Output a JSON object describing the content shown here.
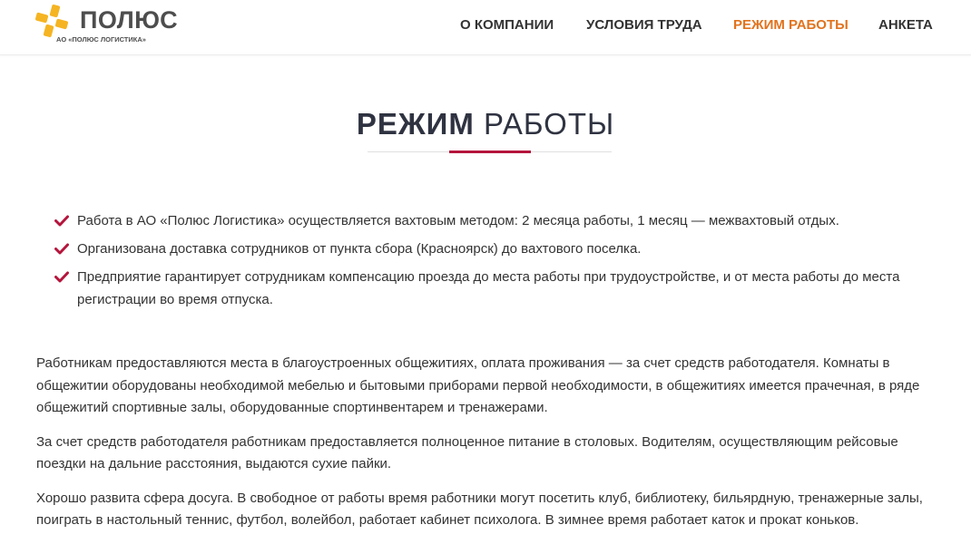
{
  "header": {
    "logo_name": "ПОЛЮС",
    "logo_sub": "АО «ПОЛЮС ЛОГИСТИКА»",
    "nav": [
      {
        "label": "О КОМПАНИИ"
      },
      {
        "label": "УСЛОВИЯ ТРУДА"
      },
      {
        "label": "РЕЖИМ РАБОТЫ",
        "active": true
      },
      {
        "label": "АНКЕТА"
      }
    ]
  },
  "main": {
    "title_strong": "РЕЖИМ",
    "title_light": "РАБОТЫ",
    "bullets": [
      "Работа в АО «Полюс Логистика» осуществляется вахтовым методом: 2 месяца работы, 1 месяц — межвахтовый отдых.",
      "Организована доставка сотрудников от пункта сбора (Красноярск) до вахтового поселка.",
      "Предприятие гарантирует сотрудникам компенсацию проезда до места работы при трудоустройстве, и от места работы до места регистрации во время отпуска."
    ],
    "paragraphs": [
      "Работникам предоставляются места в благоустроенных общежитиях, оплата проживания — за счет средств работодателя. Комнаты в общежитии оборудованы необходимой мебелью и бытовыми приборами первой необходимости, в общежитиях имеется прачечная, в ряде общежитий спортивные залы, оборудованные спортинвентарем и тренажерами.",
      "За счет средств работодателя работникам предоставляется полноценное питание в столовых. Водителям, осуществляющим рейсовые поездки на дальние расстояния, выдаются сухие пайки.",
      "Хорошо развита сфера досуга. В свободное от работы время работники могут посетить клуб, библиотеку, бильярдную, тренажерные залы, поиграть в настольный теннис, футбол, волейбол, работает кабинет психолога. В зимнее время работает каток и прокат коньков."
    ]
  },
  "colors": {
    "accent_orange": "#e1731e",
    "logo_yellow": "#f5b422",
    "title_underline": "#b5153c",
    "check": "#b5153c",
    "text": "#333333"
  },
  "icons": {
    "logo": "polyus-star-logo-icon",
    "bullet": "checkmark-icon"
  }
}
